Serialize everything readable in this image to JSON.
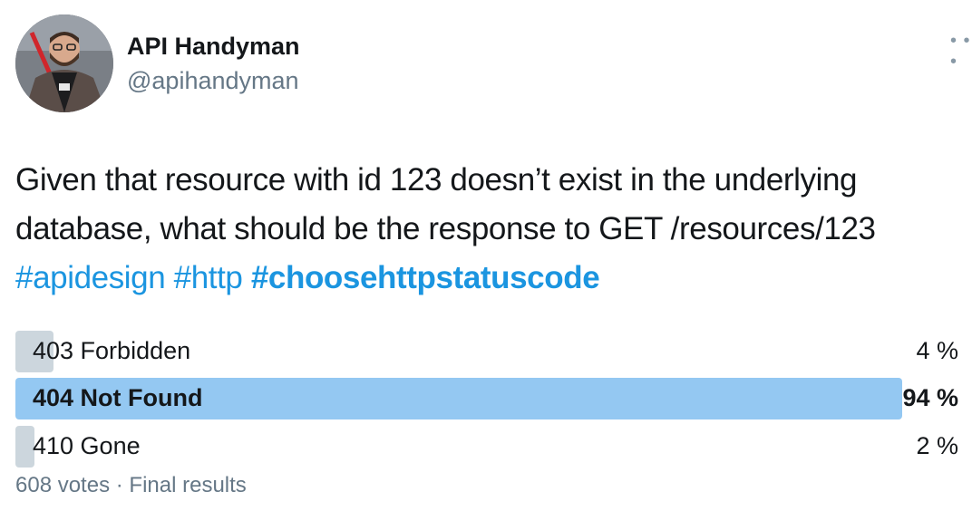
{
  "author": {
    "name": "API Handyman",
    "handle": "@apihandyman"
  },
  "tweet": {
    "line1": "Given that resource with id 123 doesn’t exist in the underlying",
    "line2": "database, what should be the response to GET /resources/123",
    "hashtags": [
      "#apidesign",
      "#http",
      "#choosehttpstatuscode"
    ]
  },
  "poll": {
    "options": [
      {
        "label": "403 Forbidden",
        "percent_text": "4 %",
        "percent": 4,
        "winner": false
      },
      {
        "label": "404 Not Found",
        "percent_text": "94 %",
        "percent": 94,
        "winner": true
      },
      {
        "label": "410 Gone",
        "percent_text": "2 %",
        "percent": 2,
        "winner": false
      }
    ],
    "votes": "608 votes",
    "separator": "·",
    "status": "Final results"
  },
  "icons": {
    "more": "more-options-icon"
  },
  "colors": {
    "link": "#1b95e0",
    "winner_bar": "#94c8f2",
    "bar": "#ccd6dd",
    "secondary_text": "#657786"
  }
}
